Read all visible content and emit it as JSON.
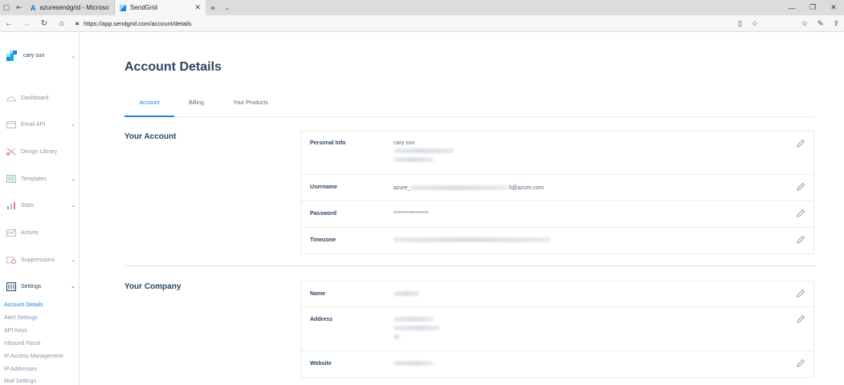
{
  "browser": {
    "tabs": [
      {
        "title": "azuresendgrid - Microsoft A",
        "close": "",
        "active": false
      },
      {
        "title": "SendGrid",
        "close": "✕",
        "active": true
      }
    ],
    "url": "https://app.sendgrid.com/account/details"
  },
  "sidebar": {
    "user_name": "cary sun",
    "nav_items": [
      {
        "label": "Dashboard",
        "icon": "dashboard-icon",
        "has_chevron": false
      },
      {
        "label": "Email API",
        "icon": "email-api-icon",
        "has_chevron": true
      },
      {
        "label": "Design Library",
        "icon": "design-library-icon",
        "has_chevron": false
      },
      {
        "label": "Templates",
        "icon": "templates-icon",
        "has_chevron": true
      },
      {
        "label": "Stats",
        "icon": "stats-icon",
        "has_chevron": true
      },
      {
        "label": "Activity",
        "icon": "activity-icon",
        "has_chevron": false
      },
      {
        "label": "Suppressions",
        "icon": "suppressions-icon",
        "has_chevron": true
      },
      {
        "label": "Settings",
        "icon": "settings-icon",
        "has_chevron": true
      }
    ],
    "settings_items": [
      {
        "label": "Account Details",
        "active": true
      },
      {
        "label": "Alert Settings",
        "active": false
      },
      {
        "label": "API Keys",
        "active": false
      },
      {
        "label": "Inbound Parse",
        "active": false
      },
      {
        "label": "IP Access Management",
        "active": false
      },
      {
        "label": "IP Addresses",
        "active": false
      },
      {
        "label": "Mail Settings",
        "active": false
      }
    ]
  },
  "main": {
    "title": "Account Details",
    "tabs": [
      {
        "label": "Account",
        "active": true
      },
      {
        "label": "Billing",
        "active": false
      },
      {
        "label": "Your Products",
        "active": false
      }
    ],
    "your_account": {
      "heading": "Your Account",
      "personal_info_label": "Personal Info",
      "personal_info_name": "cary sun",
      "username_label": "Username",
      "username_prefix": "azure_",
      "username_suffix": "5@azure.com",
      "password_label": "Password",
      "password_value": "****************",
      "timezone_label": "Timezone"
    },
    "your_company": {
      "heading": "Your Company",
      "name_label": "Name",
      "address_label": "Address",
      "website_label": "Website"
    }
  },
  "colors": {
    "accent": "#1a82e2",
    "text_dark": "#294661",
    "text_muted": "#8b97a6"
  }
}
